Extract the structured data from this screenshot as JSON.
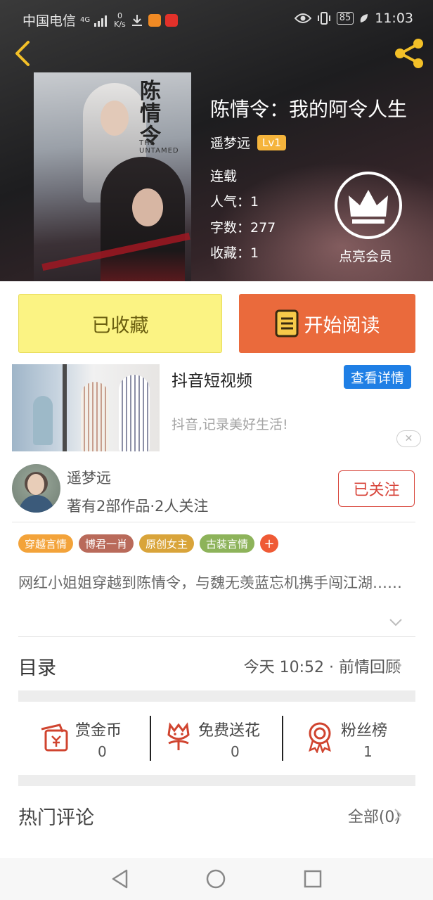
{
  "status_bar": {
    "carrier": "中国电信",
    "network": "4G",
    "speed_value": "0",
    "speed_unit": "K/s",
    "battery": "85",
    "time": "11:03"
  },
  "book": {
    "cover_title": "陈情令",
    "cover_en": "THE UNTAMED",
    "title": "陈情令：我的阿令人生",
    "author": "遥梦远",
    "level": "Lv1",
    "status": "连载",
    "popularity": "人气：1",
    "word_count": "字数：277",
    "favorites": "收藏：1",
    "vip_label": "点亮会员"
  },
  "actions": {
    "favorite_label": "已收藏",
    "read_label": "开始阅读"
  },
  "ad": {
    "title": "抖音短视频",
    "detail_button": "查看详情",
    "subtitle": "抖音,记录美好生活!",
    "close": "✕"
  },
  "author_card": {
    "name": "遥梦远",
    "summary": "著有2部作品·2人关注",
    "follow_label": "已关注"
  },
  "tags": [
    {
      "label": "穿越言情",
      "color": "#f3a33a"
    },
    {
      "label": "博君一肖",
      "color": "#b96a5a"
    },
    {
      "label": "原创女主",
      "color": "#d9a43a"
    },
    {
      "label": "古装言情",
      "color": "#8db35a"
    }
  ],
  "tag_add": "+",
  "description": "网红小姐姐穿越到陈情令，与魏无羡蓝忘机携手闯江湖……",
  "catalog": {
    "title": "目录",
    "latest": "今天 10:52 · 前情回顾"
  },
  "stats": [
    {
      "label": "赏金币",
      "value": "0",
      "icon": "red-envelope-icon"
    },
    {
      "label": "免费送花",
      "value": "0",
      "icon": "flower-icon"
    },
    {
      "label": "粉丝榜",
      "value": "1",
      "icon": "medal-icon"
    }
  ],
  "comments": {
    "title": "热门评论",
    "all_label": "全部(0)"
  },
  "colors": {
    "accent_orange": "#ea6a3c",
    "favorite_yellow": "#fbf383",
    "ad_blue": "#1f7fe5",
    "follow_red": "#d8463c",
    "icon_red": "#d0442f"
  }
}
